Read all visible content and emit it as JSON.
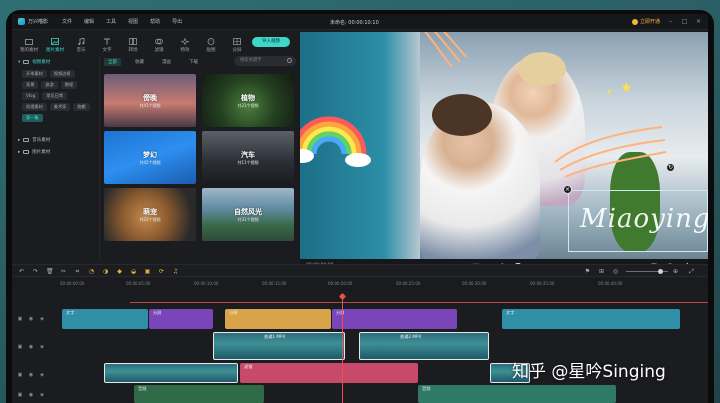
{
  "app": {
    "name": "万兴喵影",
    "menus": [
      "文件",
      "编辑",
      "工具",
      "视图",
      "帮助",
      "导出"
    ],
    "project_title": "未命名: 00:00:10:10",
    "vip_label": "立即开通"
  },
  "tool_tabs": [
    {
      "label": "我的素材",
      "icon": "folder-icon"
    },
    {
      "label": "图片素材",
      "icon": "image-icon"
    },
    {
      "label": "音乐",
      "icon": "music-icon"
    },
    {
      "label": "文字",
      "icon": "text-icon"
    },
    {
      "label": "转场",
      "icon": "transition-icon"
    },
    {
      "label": "滤镜",
      "icon": "filter-icon"
    },
    {
      "label": "特效",
      "icon": "effects-icon"
    },
    {
      "label": "贴图",
      "icon": "sticker-icon"
    },
    {
      "label": "分屏",
      "icon": "split-screen-icon"
    }
  ],
  "import_button": "导入视频",
  "tree": {
    "top": "视频素材",
    "chips": [
      "开季素材",
      "视频边框",
      "背景",
      "旅游",
      "教程",
      "Vlog",
      "常见日常",
      "纹理素材",
      "美术家",
      "跑搬",
      "第一集"
    ],
    "folders": [
      "音乐素材",
      "图片素材"
    ]
  },
  "subtabs": [
    "全部",
    "收藏",
    "漫画",
    "下载"
  ],
  "search_placeholder": "搜索关键字",
  "tiles": [
    {
      "name": "傍晚",
      "count": "共41个视频"
    },
    {
      "name": "植物",
      "count": "共21个视频"
    },
    {
      "name": "梦幻",
      "count": "共42个视频"
    },
    {
      "name": "汽车",
      "count": "共11个视频"
    },
    {
      "name": "萌宠",
      "count": "共23个视频"
    },
    {
      "name": "自然风光",
      "count": "共31个视频"
    }
  ],
  "preview": {
    "overlay_text": "Miaoying",
    "time": "00:00:00:00"
  },
  "ruler": [
    "00:00:00:00",
    "00:00:05:00",
    "00:00:10:00",
    "00:00:15:00",
    "00:00:20:00",
    "00:00:25:00",
    "00:00:30:00",
    "00:00:35:00",
    "00:00:40:00"
  ],
  "clips": {
    "text1": "文字",
    "text2": "分屏",
    "text3": "分屏",
    "text4": "分屏",
    "text5": "文字",
    "video1": "普通1.MP4",
    "video2": "普通2.MP4",
    "audio1": "滤镜",
    "music1": "音频",
    "music2": "音频"
  },
  "watermark": "知乎 @星吟Singing"
}
